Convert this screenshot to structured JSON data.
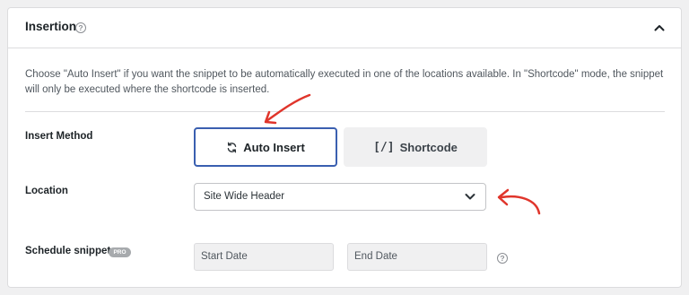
{
  "panel": {
    "title": "Insertion",
    "description": "Choose \"Auto Insert\" if you want the snippet to be automatically executed in one of the locations available. In \"Shortcode\" mode, the snippet will only be executed where the shortcode is inserted."
  },
  "insert_method": {
    "label": "Insert Method",
    "options": [
      {
        "label": "Auto Insert",
        "icon": "sync-icon",
        "selected": true
      },
      {
        "label": "Shortcode",
        "icon": "brackets-icon",
        "glyph": "[/]",
        "selected": false
      }
    ]
  },
  "location": {
    "label": "Location",
    "selected": "Site Wide Header"
  },
  "schedule": {
    "label": "Schedule snippet",
    "badge": "PRO",
    "start_placeholder": "Start Date",
    "end_placeholder": "End Date"
  },
  "colors": {
    "accent": "#3a5fb0",
    "annotation": "#e0352b",
    "background": "#f0f0f1"
  }
}
